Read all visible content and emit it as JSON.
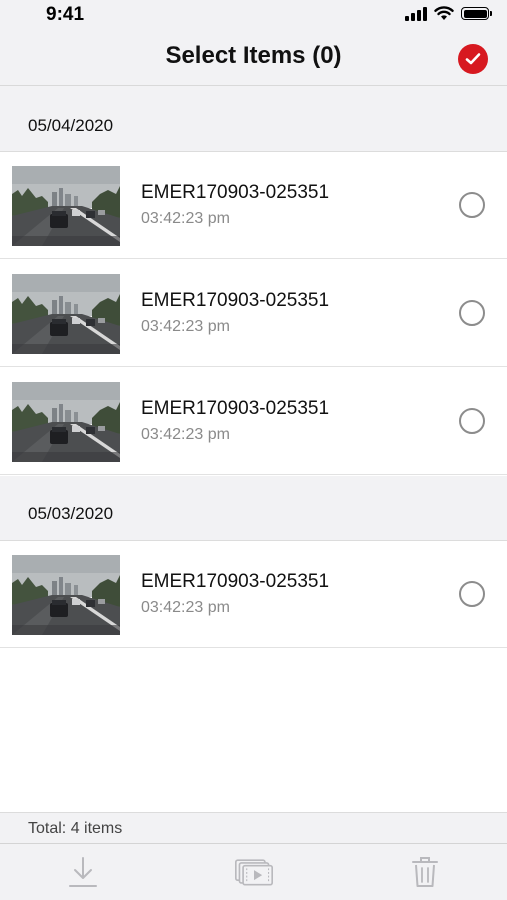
{
  "status_bar": {
    "time": "9:41"
  },
  "nav": {
    "title": "Select Items (0)"
  },
  "sections": [
    {
      "date": "05/04/2020",
      "items": [
        {
          "name": "EMER170903-025351",
          "time": "03:42:23 pm",
          "selected": false
        },
        {
          "name": "EMER170903-025351",
          "time": "03:42:23 pm",
          "selected": false
        },
        {
          "name": "EMER170903-025351",
          "time": "03:42:23 pm",
          "selected": false
        }
      ]
    },
    {
      "date": "05/03/2020",
      "items": [
        {
          "name": "EMER170903-025351",
          "time": "03:42:23 pm",
          "selected": false
        }
      ]
    }
  ],
  "footer": {
    "total": "Total: 4 items"
  },
  "toolbar": {
    "icons": [
      "download-icon",
      "video-gallery-icon",
      "trash-icon"
    ]
  },
  "colors": {
    "accent": "#d71920",
    "background": "#f2f2f4",
    "secondary_text": "#8a8a8a"
  }
}
